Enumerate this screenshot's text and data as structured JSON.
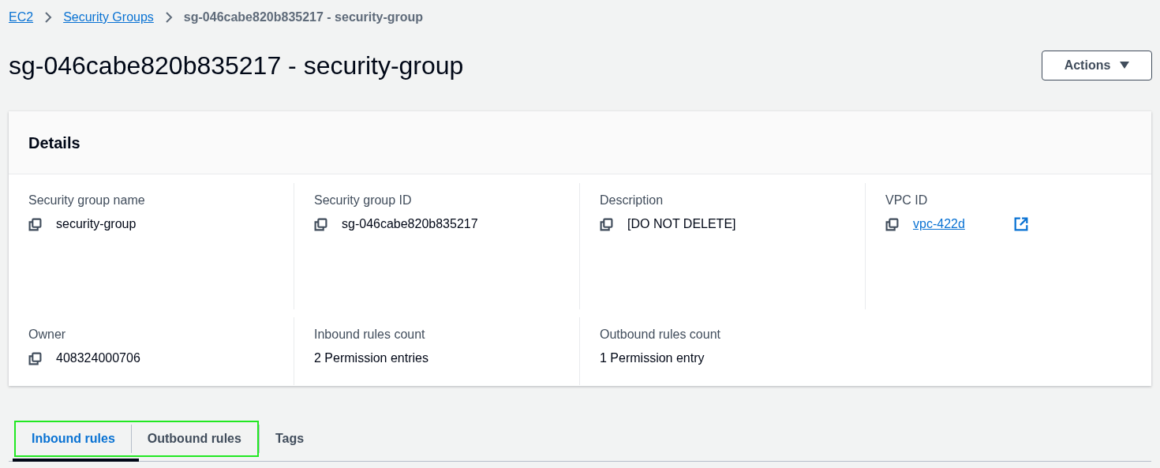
{
  "breadcrumb": [
    {
      "label": "EC2",
      "kind": "link"
    },
    {
      "label": "Security Groups",
      "kind": "link"
    },
    {
      "label": "sg-046cabe820b835217 - security-group",
      "kind": "current"
    }
  ],
  "page_title": "sg-046cabe820b835217 - security-group",
  "actions_button": {
    "label": "Actions"
  },
  "details": {
    "title": "Details",
    "rows": [
      [
        {
          "label": "Security group name",
          "value": "security-group",
          "copyable": true,
          "link": false,
          "external": false
        },
        {
          "label": "Security group ID",
          "value": "sg-046cabe820b835217",
          "copyable": true,
          "link": false,
          "external": false
        },
        {
          "label": "Description",
          "value": "[DO NOT DELETE]",
          "copyable": true,
          "link": false,
          "external": false
        },
        {
          "label": "VPC ID",
          "value": "vpc-422d",
          "copyable": true,
          "link": true,
          "external": true
        }
      ],
      [
        {
          "label": "Owner",
          "value": "408324000706",
          "copyable": true,
          "link": false,
          "external": false
        },
        {
          "label": "Inbound rules count",
          "value": "2 Permission entries",
          "copyable": false,
          "link": false,
          "external": false
        },
        {
          "label": "Outbound rules count",
          "value": "1 Permission entry",
          "copyable": false,
          "link": false,
          "external": false
        }
      ]
    ]
  },
  "tabs": [
    {
      "label": "Inbound rules",
      "selected": true,
      "highlighted": true
    },
    {
      "label": "Outbound rules",
      "selected": false,
      "highlighted": true
    },
    {
      "label": "Tags",
      "selected": false,
      "highlighted": false
    }
  ]
}
